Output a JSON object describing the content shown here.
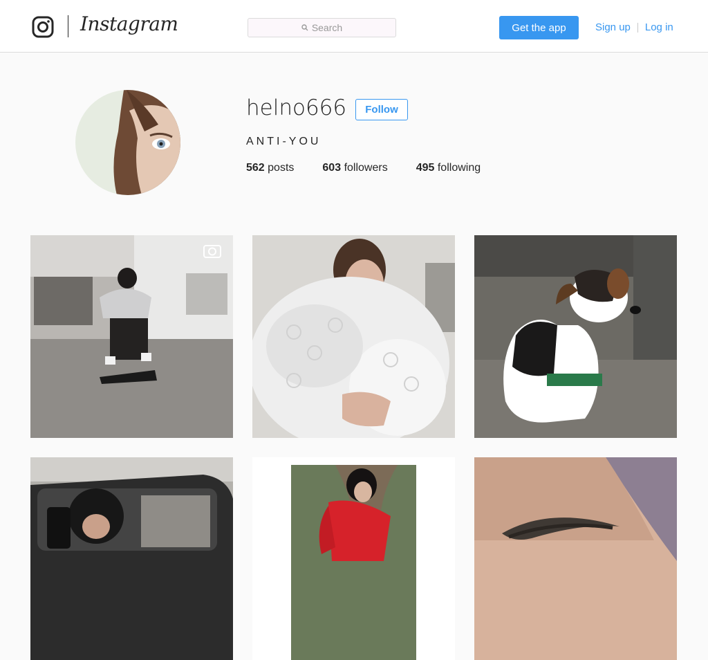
{
  "header": {
    "wordmark": "Instagram",
    "search_placeholder": "Search",
    "get_app_label": "Get the app",
    "signup_label": "Sign up",
    "login_label": "Log in"
  },
  "profile": {
    "username": "helno666",
    "follow_label": "Follow",
    "full_name": "ANTI-YOU",
    "posts_count": "562",
    "posts_label": "posts",
    "followers_count": "603",
    "followers_label": "followers",
    "following_count": "495",
    "following_label": "following"
  },
  "colors": {
    "accent": "#3897f0",
    "text": "#262626",
    "background": "#fafafa",
    "border": "#dbdbdb"
  },
  "posts": [
    {
      "subject": "person on scooter in warehouse",
      "is_video": true
    },
    {
      "subject": "woman wrapped in bubble wrap",
      "is_video": false
    },
    {
      "subject": "dog sitting on floor",
      "is_video": false
    },
    {
      "subject": "car mirror selfie",
      "is_video": false
    },
    {
      "subject": "woman in red jacket by tree",
      "is_video": false
    },
    {
      "subject": "eyebrow close-up",
      "is_video": false
    }
  ]
}
